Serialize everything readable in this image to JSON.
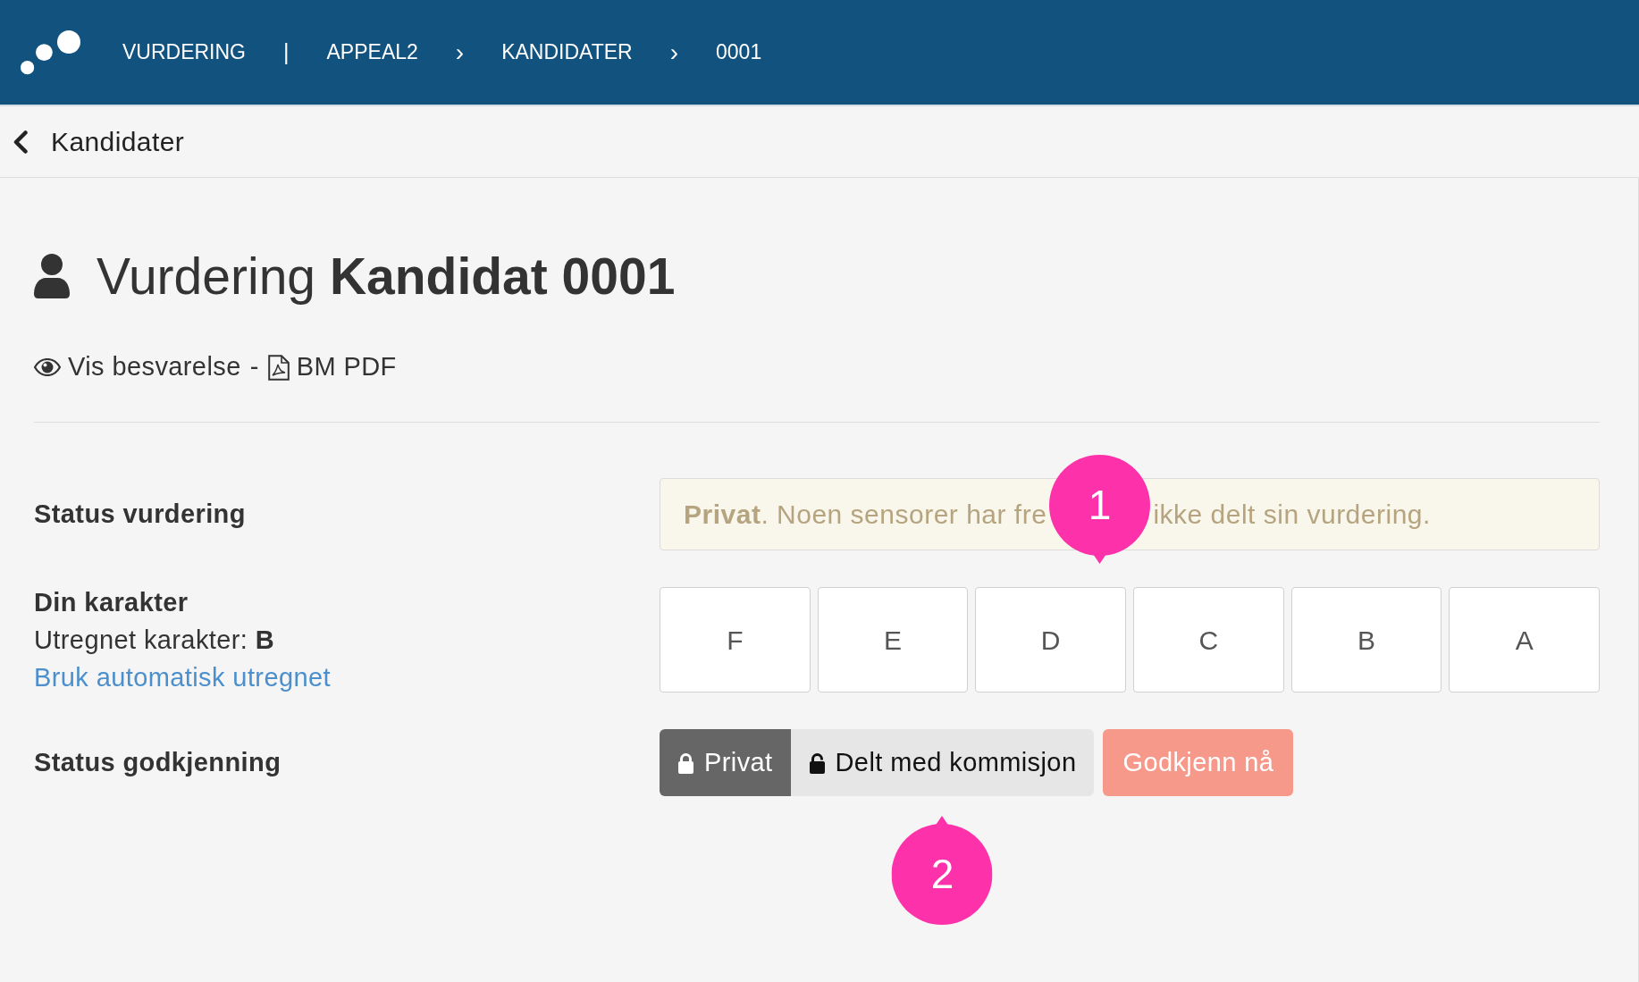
{
  "header": {
    "breadcrumb": [
      {
        "kind": "section",
        "text": "VURDERING"
      },
      {
        "kind": "divider",
        "text": "|"
      },
      {
        "kind": "crumb",
        "text": "APPEAL2"
      },
      {
        "kind": "separator",
        "text": "›"
      },
      {
        "kind": "crumb",
        "text": "KANDIDATER"
      },
      {
        "kind": "separator",
        "text": "›"
      },
      {
        "kind": "crumb",
        "text": "0001"
      }
    ]
  },
  "back_link": {
    "label": "Kandidater"
  },
  "page_title": "Vurdering **Kandidat 0001**",
  "answer_links": {
    "items": [
      {
        "kind": "view",
        "label": "Vis besvarelse"
      },
      {
        "kind": "pdf",
        "label": "BM PDF"
      }
    ],
    "separator": "-"
  },
  "assessment_status": {
    "label": "Status vurdering",
    "message": [
      {
        "kind": "text",
        "text": "**Privat**. Noen sensorer har fre"
      },
      {
        "kind": "callout",
        "label": "1",
        "points_down": true
      },
      {
        "kind": "text",
        "text": "ikke delt sin vurdering."
      }
    ]
  },
  "grade": {
    "label": "Din karakter",
    "computed": "Utregnet karakter: **B**",
    "link": "Bruk automatisk utregnet",
    "options": [
      {
        "label": "F",
        "selected": false
      },
      {
        "label": "E",
        "selected": false
      },
      {
        "label": "D",
        "selected": false
      },
      {
        "label": "C",
        "selected": false
      },
      {
        "label": "B",
        "selected": false
      },
      {
        "label": "A",
        "selected": false
      }
    ]
  },
  "approval_status": {
    "label": "Status godkjenning",
    "options": [
      {
        "kind": "locked",
        "label": "Privat",
        "selected": true
      },
      {
        "kind": "unlocked",
        "label": "Delt med kommisjon",
        "selected": false,
        "callout": {
          "label": "2",
          "points_down": false
        }
      }
    ],
    "approve_button": {
      "label": "Godkjenn nå",
      "disabled": true
    }
  }
}
